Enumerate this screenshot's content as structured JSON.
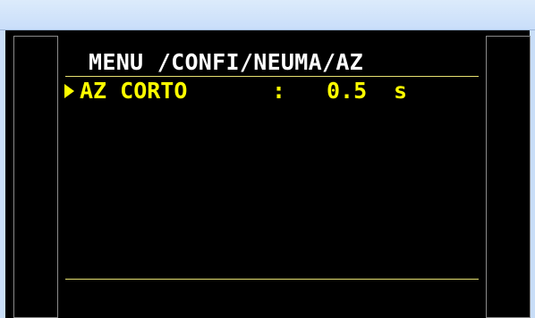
{
  "display": {
    "title": "MENU /CONFI/NEUMA/AZ",
    "items": [
      {
        "label": "AZ CORTO",
        "separator": ":",
        "value": "0.5",
        "unit": "s",
        "selected": true
      }
    ]
  },
  "colors": {
    "background": "#000000",
    "title_text": "#ffffff",
    "item_text": "#ffff00",
    "rule": "#e6e070",
    "window_chrome": "#c9defa"
  },
  "icons": {
    "selector": "triangle-right-icon"
  }
}
